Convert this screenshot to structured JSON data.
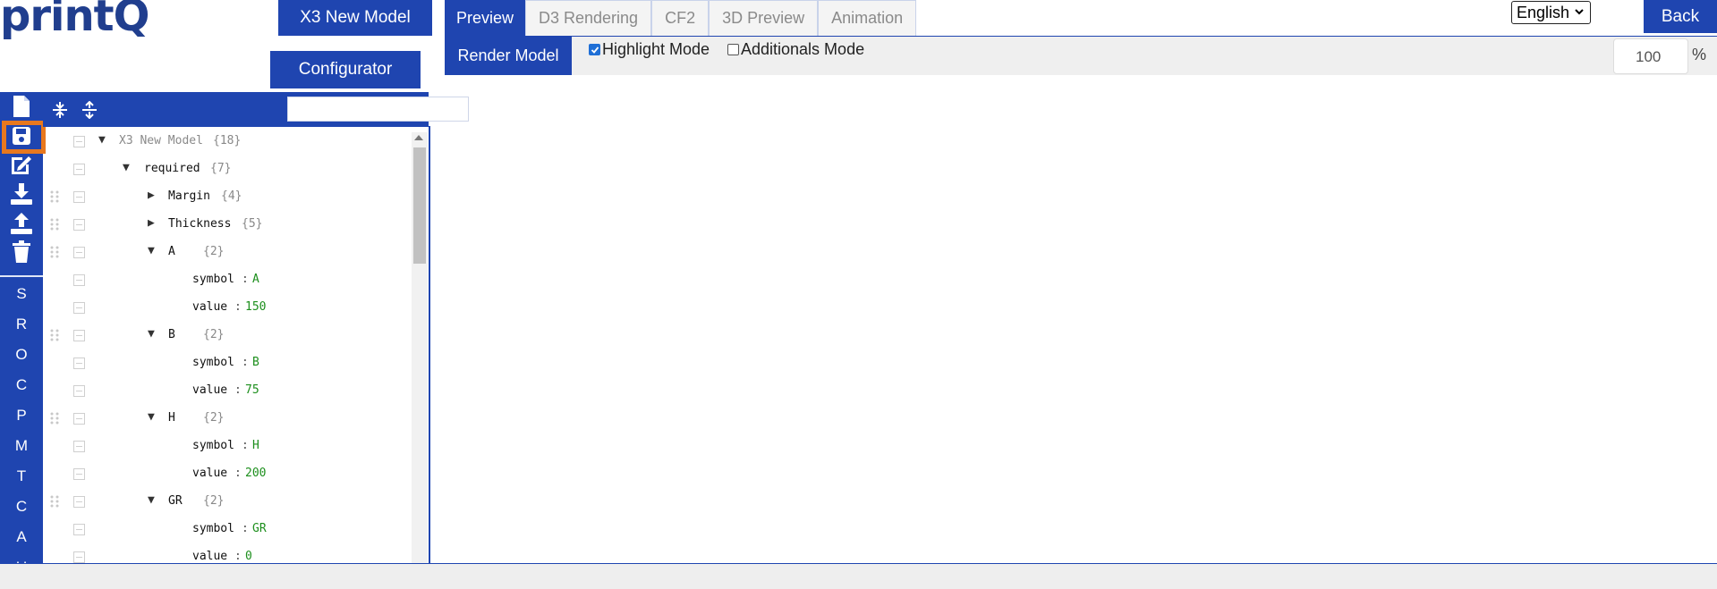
{
  "brand": {
    "logo": "printQ"
  },
  "header": {
    "model_button": "X3 New Model",
    "configurator_button": "Configurator",
    "tabs": [
      {
        "label": "Preview",
        "active": true
      },
      {
        "label": "D3 Rendering",
        "active": false
      },
      {
        "label": "CF2",
        "active": false
      },
      {
        "label": "3D Preview",
        "active": false
      },
      {
        "label": "Animation",
        "active": false
      }
    ],
    "language": "English",
    "back_button": "Back"
  },
  "preview_toolbar": {
    "render_button": "Render Model",
    "highlight_mode": {
      "label": "Highlight Mode",
      "checked": true
    },
    "additionals_mode": {
      "label": "Additionals Mode",
      "checked": false
    },
    "zoom_value": "100",
    "zoom_unit": "%"
  },
  "tree_toolbar": {
    "search_value": ""
  },
  "left_rail": {
    "icons": [
      "new-file-icon",
      "save-icon",
      "edit-icon",
      "download-icon",
      "upload-icon",
      "trash-icon"
    ],
    "letters": [
      "S",
      "R",
      "O",
      "C",
      "P",
      "M",
      "T",
      "C",
      "A",
      "U"
    ]
  },
  "tree": {
    "root": {
      "key": "X3 New Model",
      "count": "{18}"
    },
    "rows": [
      {
        "key": "required",
        "count": "{7}"
      },
      {
        "key": "Margin",
        "count": "{4}"
      },
      {
        "key": "Thickness",
        "count": "{5}"
      },
      {
        "key": "A",
        "count": "{2}"
      },
      {
        "key": "symbol",
        "sep": ":",
        "value": "A"
      },
      {
        "key": "value",
        "sep": ":",
        "value": "150"
      },
      {
        "key": "B",
        "count": "{2}"
      },
      {
        "key": "symbol",
        "sep": ":",
        "value": "B"
      },
      {
        "key": "value",
        "sep": ":",
        "value": "75"
      },
      {
        "key": "H",
        "count": "{2}"
      },
      {
        "key": "symbol",
        "sep": ":",
        "value": "H"
      },
      {
        "key": "value",
        "sep": ":",
        "value": "200"
      },
      {
        "key": "GR",
        "count": "{2}"
      },
      {
        "key": "symbol",
        "sep": ":",
        "value": "GR"
      },
      {
        "key": "value",
        "sep": ":",
        "value": "0"
      }
    ],
    "expanded_toggle": "▼",
    "collapsed_toggle": "▶"
  },
  "colors": {
    "brand_blue": "#1f45b0",
    "logo_blue": "#203e8e",
    "highlight_orange": "#e8781e",
    "value_green": "#1d8f1d"
  }
}
